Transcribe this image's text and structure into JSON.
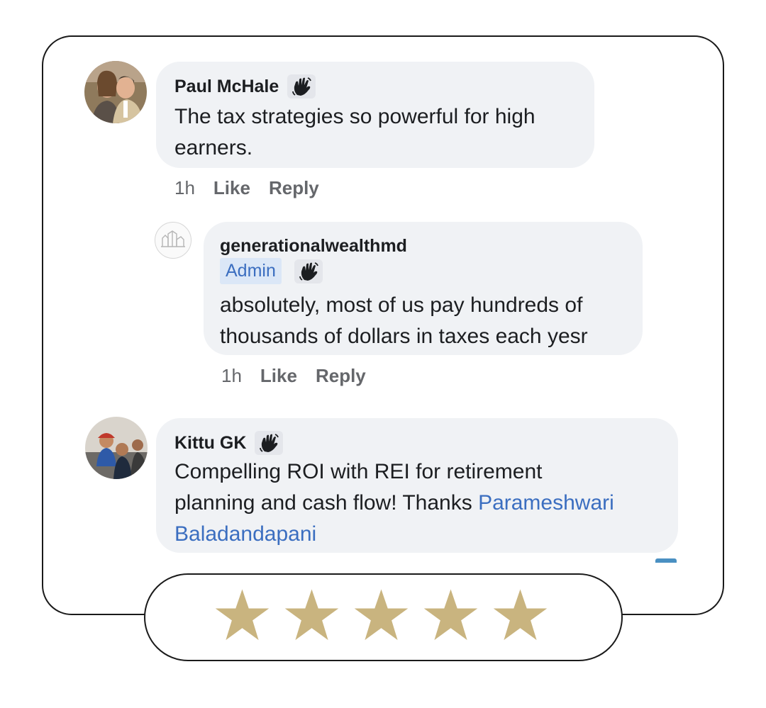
{
  "comments": [
    {
      "author": "Paul McHale",
      "text_lines": [
        "The tax strategies so powerful for high",
        "earners."
      ],
      "time": "1h",
      "like_label": "Like",
      "reply_label": "Reply",
      "badge_icon": "waving-hand-icon"
    },
    {
      "author": "generationalwealthmd",
      "role_badge": "Admin",
      "text_lines": [
        "absolutely, most of us pay hundreds of",
        "thousands of dollars in taxes each yesr"
      ],
      "time": "1h",
      "like_label": "Like",
      "reply_label": "Reply",
      "badge_icon": "waving-hand-icon"
    },
    {
      "author": "Kittu GK",
      "text_line1": "Compelling ROI with REI for retirement",
      "text_line2_prefix": "planning and cash flow!  Thanks ",
      "mention_part1": "Parameshwari",
      "mention_part2": "Baladandapani",
      "badge_icon": "waving-hand-icon"
    }
  ],
  "rating": {
    "stars": 5,
    "max": 5,
    "star_color": "#c9b47f"
  },
  "colors": {
    "bubble": "#f0f2f5",
    "mention": "#3b6ec0",
    "admin_bg": "#dbe7f7",
    "secondary_text": "#65676b"
  }
}
